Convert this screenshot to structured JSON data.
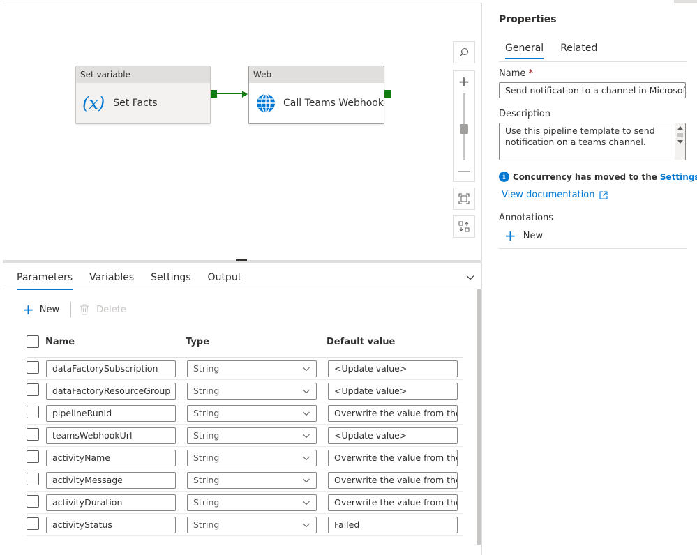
{
  "canvas": {
    "activities": [
      {
        "type_label": "Set variable",
        "name": "Set Facts",
        "icon": "fx-icon"
      },
      {
        "type_label": "Web",
        "name": "Call Teams Webhook",
        "icon": "globe-icon"
      }
    ],
    "controls": [
      "search-icon",
      "zoom-in-icon",
      "zoom-out-icon",
      "fit-to-screen-icon",
      "auto-align-icon"
    ],
    "fx_open": "(",
    "fx_x": "x",
    "fx_close": ")"
  },
  "bottom_panel": {
    "tabs": [
      "Parameters",
      "Variables",
      "Settings",
      "Output"
    ],
    "active_tab": "Parameters",
    "toolbar": {
      "new_label": "New",
      "delete_label": "Delete"
    },
    "columns": {
      "name": "Name",
      "type": "Type",
      "default": "Default value"
    },
    "rows": [
      {
        "name": "dataFactorySubscription",
        "type": "String",
        "default": "<Update value>"
      },
      {
        "name": "dataFactoryResourceGroup",
        "type": "String",
        "default": "<Update value>"
      },
      {
        "name": "pipelineRunId",
        "type": "String",
        "default": "Overwrite the value from the"
      },
      {
        "name": "teamsWebhookUrl",
        "type": "String",
        "default": "<Update value>"
      },
      {
        "name": "activityName",
        "type": "String",
        "default": "Overwrite the value from the"
      },
      {
        "name": "activityMessage",
        "type": "String",
        "default": "Overwrite the value from the"
      },
      {
        "name": "activityDuration",
        "type": "String",
        "default": "Overwrite the value from the"
      },
      {
        "name": "activityStatus",
        "type": "String",
        "default": "Failed"
      }
    ]
  },
  "properties": {
    "title": "Properties",
    "tabs": [
      "General",
      "Related"
    ],
    "active_tab": "General",
    "name_label": "Name",
    "required_mark": "*",
    "name_value": "Send notification to a channel in Microsoft Teams",
    "description_label": "Description",
    "description_value": "Use this pipeline template to send notification on a teams channel.",
    "info_text": "Concurrency has moved to the",
    "info_link": "Settings tab.",
    "info_glyph": "i",
    "view_doc": "View documentation",
    "annotations_label": "Annotations",
    "annotations_new": "New"
  },
  "colors": {
    "accent": "#0078d4",
    "success": "#107c10",
    "required": "#a4262c"
  }
}
